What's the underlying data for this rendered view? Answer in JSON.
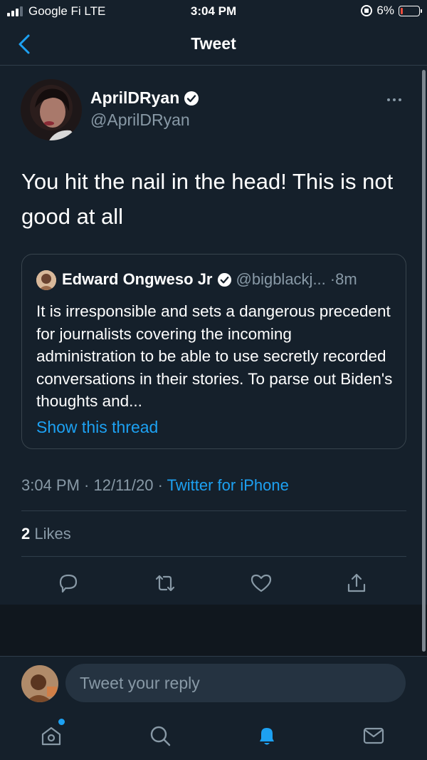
{
  "status_bar": {
    "carrier": "Google Fi  LTE",
    "time": "3:04 PM",
    "battery": "6%"
  },
  "nav": {
    "title": "Tweet",
    "back_icon": "chevron-left-icon"
  },
  "tweet": {
    "author_name": "AprilDRyan",
    "author_handle": "@AprilDRyan",
    "text": "You hit the nail in the head! This is not good at all",
    "timestamp": "3:04 PM · 12/11/20 · ",
    "source": "Twitter for iPhone",
    "likes_count": "2",
    "likes_label": " Likes"
  },
  "quoted_tweet": {
    "author_name": "Edward Ongweso Jr",
    "author_handle": "@bigblackj...",
    "time": "·8m",
    "text": "It is irresponsible and sets a dangerous precedent for journalists covering the incoming administration to be able to use secretly recorded conversations in their stories. To parse out Biden's thoughts and...",
    "show_thread": "Show this thread"
  },
  "actions": [
    "reply-icon",
    "retweet-icon",
    "like-icon",
    "share-icon"
  ],
  "reply_bar": {
    "placeholder": "Tweet your reply"
  },
  "tab_bar": [
    "home-icon",
    "search-icon",
    "notifications-icon",
    "messages-icon"
  ],
  "colors": {
    "background": "#15202b",
    "accent": "#1da1f2",
    "secondary_text": "#8899a6",
    "border": "#38444d"
  }
}
